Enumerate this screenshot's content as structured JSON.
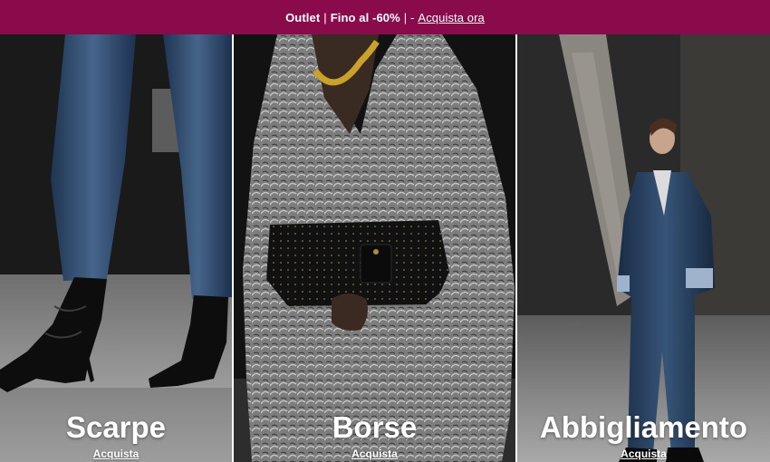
{
  "colors": {
    "promo_bg": "#8a0b4b",
    "text": "#ffffff"
  },
  "promo": {
    "label": "Outlet",
    "separator_1": "|",
    "offer": "Fino al -60%",
    "separator_2": "| -",
    "link": "Acquista ora"
  },
  "tiles": [
    {
      "title": "Scarpe",
      "link": "Acquista"
    },
    {
      "title": "Borse",
      "link": "Acquista"
    },
    {
      "title": "Abbigliamento",
      "link": "Acquista"
    }
  ]
}
